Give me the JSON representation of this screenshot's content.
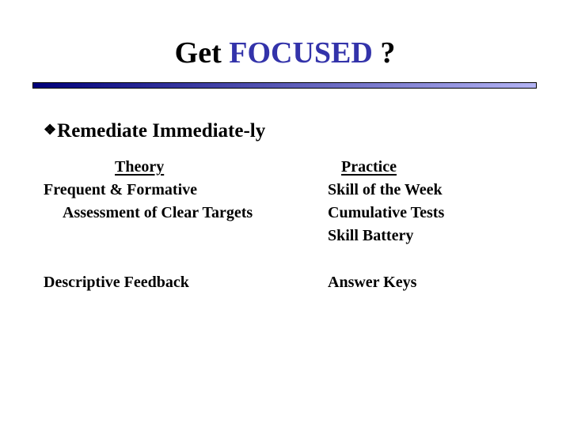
{
  "title": {
    "prefix": "Get",
    "accent": "FOCUSED",
    "suffix": "?",
    "accent_color": "#3333aa"
  },
  "title_bar": {
    "gradient_start": "#00007a",
    "gradient_end": "#b4b4f4"
  },
  "bullet": {
    "icon": "diamond-bullet-icon",
    "glyph": "❖",
    "text": "Remediate Immediate-ly"
  },
  "theory": {
    "heading": "Theory",
    "lines": [
      "Frequent & Formative",
      "Assessment of Clear Targets"
    ],
    "bottom": "Descriptive Feedback"
  },
  "practice": {
    "heading": "Practice",
    "lines": [
      "Skill of the Week",
      "Cumulative Tests",
      "Skill Battery"
    ],
    "bottom": "Answer Keys"
  }
}
